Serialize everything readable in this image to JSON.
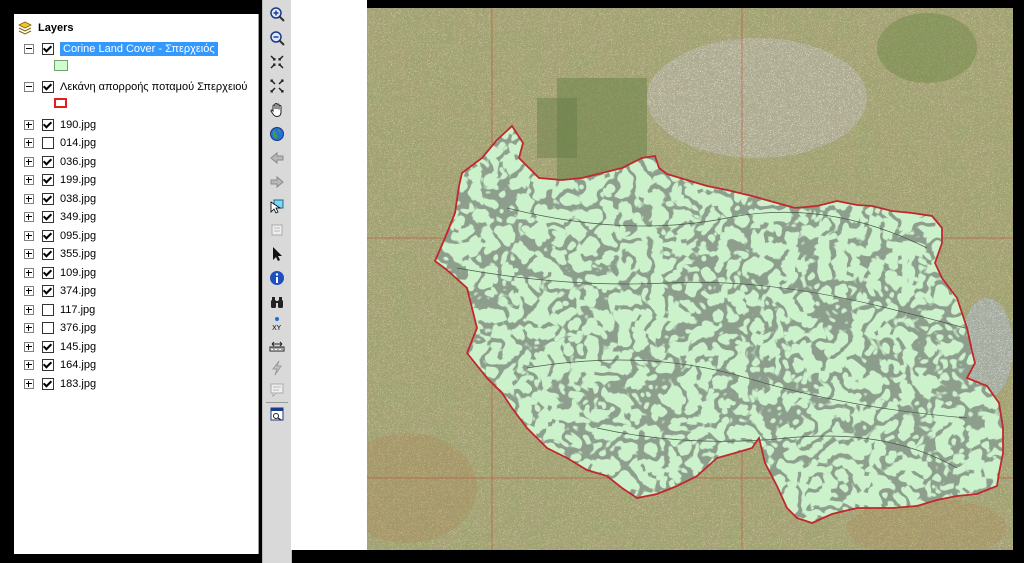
{
  "toc": {
    "header": "Layers",
    "layers": [
      {
        "name": "Corine Land Cover - Σπερχειός",
        "checked": true,
        "expanded": true,
        "selected": true,
        "swatch": "#ccffcc"
      },
      {
        "name": "Λεκάνη απορροής ποταμού Σπερχειού",
        "checked": true,
        "expanded": true,
        "selected": false,
        "swatch": "#e02020"
      },
      {
        "name": "190.jpg",
        "checked": true
      },
      {
        "name": "014.jpg",
        "checked": false
      },
      {
        "name": "036.jpg",
        "checked": true
      },
      {
        "name": "199.jpg",
        "checked": true
      },
      {
        "name": "038.jpg",
        "checked": true
      },
      {
        "name": "349.jpg",
        "checked": true
      },
      {
        "name": "095.jpg",
        "checked": true
      },
      {
        "name": "355.jpg",
        "checked": true
      },
      {
        "name": "109.jpg",
        "checked": true
      },
      {
        "name": "374.jpg",
        "checked": true
      },
      {
        "name": "117.jpg",
        "checked": false
      },
      {
        "name": "376.jpg",
        "checked": false
      },
      {
        "name": "145.jpg",
        "checked": true
      },
      {
        "name": "164.jpg",
        "checked": true
      },
      {
        "name": "183.jpg",
        "checked": true
      }
    ]
  },
  "toolbar": {
    "tools": [
      "zoom-in-icon",
      "zoom-out-icon",
      "fixed-zoom-in-icon",
      "fixed-zoom-out-icon",
      "pan-hand-icon",
      "full-extent-globe-icon",
      "back-arrow-icon",
      "forward-arrow-icon",
      "select-features-icon",
      "clear-selection-icon",
      "select-pointer-icon",
      "identify-info-icon",
      "find-binoculars-icon",
      "go-to-xy-icon",
      "measure-icon",
      "hyperlink-bolt-icon",
      "html-popup-icon",
      "viewer-window-icon"
    ]
  },
  "map": {
    "colors": {
      "land_cover_fill": "#ccf2cc",
      "basin_outline": "#c0282d",
      "polygons": "#4a5a4a",
      "topo_base": "#c9c98a"
    }
  }
}
